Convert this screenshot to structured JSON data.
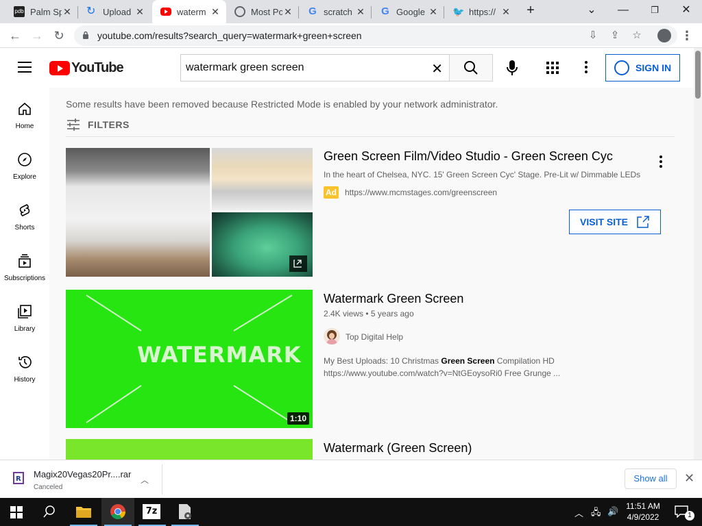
{
  "browser": {
    "tabs": [
      {
        "title": "Palm Sp",
        "favicon": "pdb-icon",
        "color": "#222222"
      },
      {
        "title": "Upload",
        "favicon": "upload-arrow-icon",
        "color": "#1a73e8"
      },
      {
        "title": "waterm",
        "favicon": "youtube-icon",
        "color": "#ff0000",
        "active": true
      },
      {
        "title": "Most Po",
        "favicon": "globe-icon",
        "color": "#5f6368"
      },
      {
        "title": "scratch",
        "favicon": "google-icon",
        "color": "#4285f4"
      },
      {
        "title": "Google",
        "favicon": "google-icon",
        "color": "#4285f4"
      },
      {
        "title": "https://",
        "favicon": "twitter-icon",
        "color": "#1da1f2"
      }
    ],
    "new_tab_symbol": "+",
    "url": "youtube.com/results?search_query=watermark+green+screen"
  },
  "youtube": {
    "logo_text": "YouTube",
    "search_query": "watermark green screen",
    "sign_in": "SIGN IN",
    "guide": [
      {
        "label": "Home",
        "icon": "home-icon"
      },
      {
        "label": "Explore",
        "icon": "compass-icon"
      },
      {
        "label": "Shorts",
        "icon": "shorts-icon"
      },
      {
        "label": "Subscriptions",
        "icon": "subscriptions-icon"
      },
      {
        "label": "Library",
        "icon": "library-icon"
      },
      {
        "label": "History",
        "icon": "history-icon"
      }
    ],
    "notice": "Some results have been removed because Restricted Mode is enabled by your network administrator.",
    "filters_label": "FILTERS",
    "ad": {
      "title": "Green Screen Film/Video Studio - Green Screen Cyc",
      "description": "In the heart of Chelsea, NYC. 15' Green Screen Cyc' Stage. Pre-Lit w/ Dimmable LEDs",
      "badge": "Ad",
      "url": "https://www.mcmstages.com/greenscreen",
      "cta": "VISIT SITE"
    },
    "results": [
      {
        "title": "Watermark Green Screen",
        "views": "2.4K views",
        "age": "5 years ago",
        "channel": "Top Digital Help",
        "thumb_text": "WATERMARK",
        "duration": "1:10",
        "desc_prefix": "My Best Uploads: 10 Christmas ",
        "desc_bold": "Green Screen",
        "desc_suffix": " Compilation HD",
        "desc_line2": "https://www.youtube.com/watch?v=NtGEoysoRi0 Free Grunge ..."
      },
      {
        "title": "Watermark (Green Screen)"
      }
    ]
  },
  "download": {
    "filename": "Magix20Vegas20Pr....rar",
    "status": "Canceled",
    "show_all": "Show all"
  },
  "taskbar": {
    "time": "11:51 AM",
    "date": "4/9/2022",
    "notification_count": "1",
    "apps": [
      "start-icon",
      "search-icon",
      "file-explorer-icon",
      "chrome-icon",
      "7zip-icon",
      "file-icon"
    ]
  }
}
